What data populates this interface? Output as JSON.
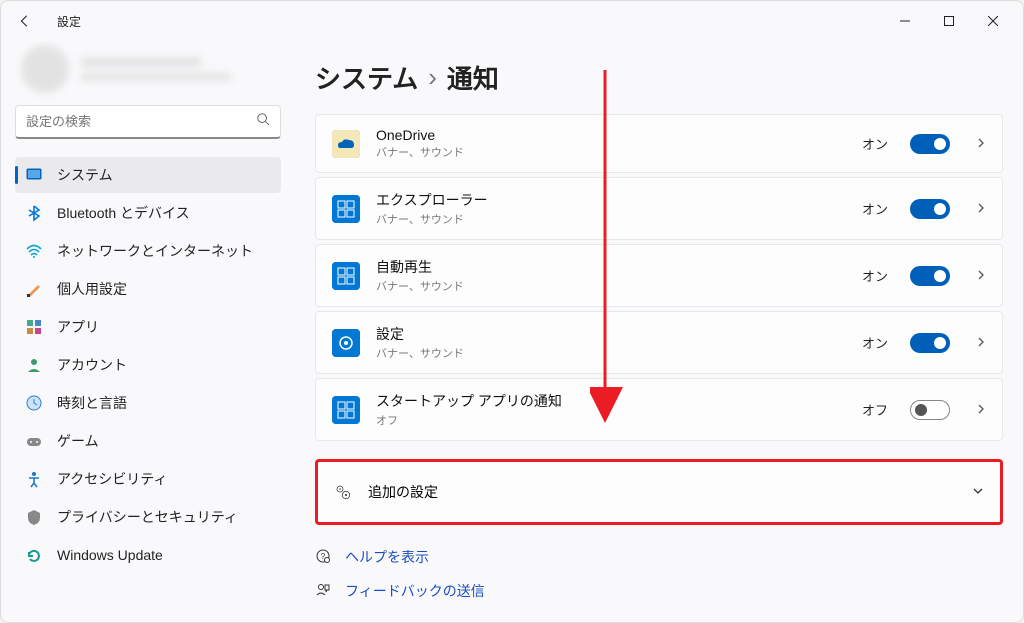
{
  "titlebar": {
    "title": "設定"
  },
  "search": {
    "placeholder": "設定の検索"
  },
  "nav": [
    {
      "label": "システム",
      "icon": "system",
      "active": true
    },
    {
      "label": "Bluetooth とデバイス",
      "icon": "bluetooth"
    },
    {
      "label": "ネットワークとインターネット",
      "icon": "network"
    },
    {
      "label": "個人用設定",
      "icon": "personalize"
    },
    {
      "label": "アプリ",
      "icon": "apps"
    },
    {
      "label": "アカウント",
      "icon": "account"
    },
    {
      "label": "時刻と言語",
      "icon": "time"
    },
    {
      "label": "ゲーム",
      "icon": "gaming"
    },
    {
      "label": "アクセシビリティ",
      "icon": "accessibility"
    },
    {
      "label": "プライバシーとセキュリティ",
      "icon": "privacy"
    },
    {
      "label": "Windows Update",
      "icon": "update"
    }
  ],
  "breadcrumb": {
    "parent": "システム",
    "current": "通知"
  },
  "apps": [
    {
      "name": "OneDrive",
      "sub": "バナー、サウンド",
      "state": "オン",
      "on": true,
      "icon": "onedrive"
    },
    {
      "name": "エクスプローラー",
      "sub": "バナー、サウンド",
      "state": "オン",
      "on": true,
      "icon": "explorer"
    },
    {
      "name": "自動再生",
      "sub": "バナー、サウンド",
      "state": "オン",
      "on": true,
      "icon": "autoplay"
    },
    {
      "name": "設定",
      "sub": "バナー、サウンド",
      "state": "オン",
      "on": true,
      "icon": "settings"
    },
    {
      "name": "スタートアップ アプリの通知",
      "sub": "オフ",
      "state": "オフ",
      "on": false,
      "icon": "startup"
    }
  ],
  "expander": {
    "label": "追加の設定"
  },
  "links": {
    "help": "ヘルプを表示",
    "feedback": "フィードバックの送信"
  }
}
